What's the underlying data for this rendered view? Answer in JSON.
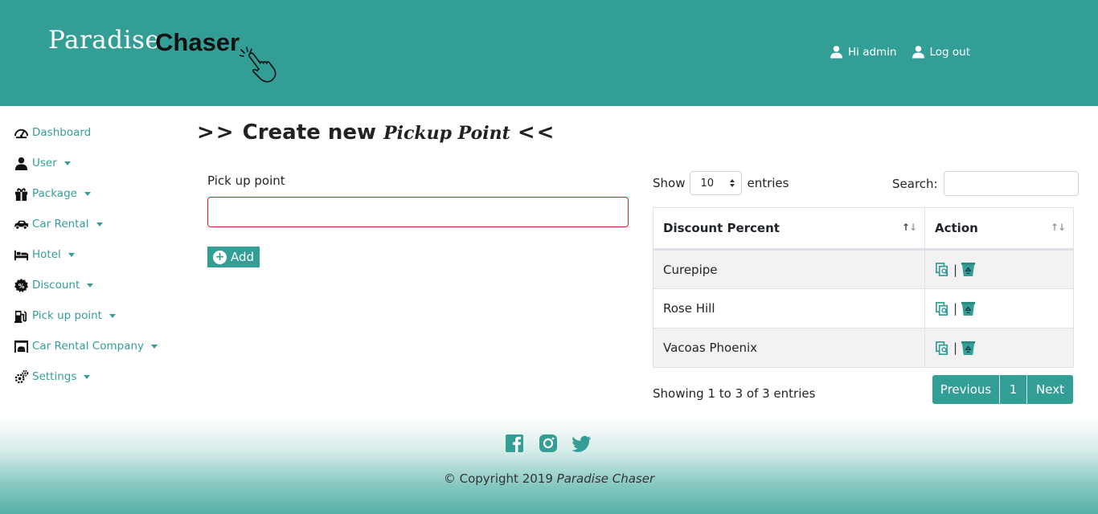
{
  "brand": {
    "word1": "Paradise",
    "word2": "Chaser",
    "hand_icon": "pointing-hand-icon"
  },
  "colors": {
    "primary": "#339e96",
    "invalid_border": "#c82333",
    "striped_row": "#f2f2f2"
  },
  "header": {
    "greeting": "Hi admin",
    "logout": "Log out"
  },
  "sidebar": {
    "items": [
      {
        "label": "Dashboard",
        "icon": "dashboard-icon",
        "dropdown": false
      },
      {
        "label": "User",
        "icon": "user-icon",
        "dropdown": true
      },
      {
        "label": "Package",
        "icon": "gift-icon",
        "dropdown": true
      },
      {
        "label": "Car Rental",
        "icon": "car-icon",
        "dropdown": true
      },
      {
        "label": "Hotel",
        "icon": "bed-icon",
        "dropdown": true
      },
      {
        "label": "Discount",
        "icon": "discount-badge-icon",
        "dropdown": true
      },
      {
        "label": "Pick up point",
        "icon": "gas-station-icon",
        "dropdown": true
      },
      {
        "label": "Car Rental Company",
        "icon": "garage-icon",
        "dropdown": true
      },
      {
        "label": "Settings",
        "icon": "gears-icon",
        "dropdown": true
      }
    ]
  },
  "page": {
    "title_prefix": ">>",
    "title_bold": "Create new",
    "title_italic": "Pickup Point",
    "title_suffix": "<<"
  },
  "form": {
    "label": "Pick up point",
    "value": "",
    "add_label": "Add"
  },
  "table": {
    "show_label": "Show",
    "entries_label": "entries",
    "length_value": "10",
    "search_label": "Search:",
    "search_value": "",
    "headers": [
      "Discount Percent",
      "Action"
    ],
    "rows": [
      "Curepipe",
      "Rose Hill",
      "Vacoas Phoenix"
    ],
    "action_separator": "|",
    "info": "Showing 1 to 3 of 3 entries",
    "pagination": {
      "previous": "Previous",
      "page": "1",
      "next": "Next"
    }
  },
  "footer": {
    "copyright_prefix": "© Copyright 2019",
    "copyright_name": "Paradise Chaser",
    "social": [
      "facebook-icon",
      "instagram-icon",
      "twitter-icon"
    ]
  }
}
